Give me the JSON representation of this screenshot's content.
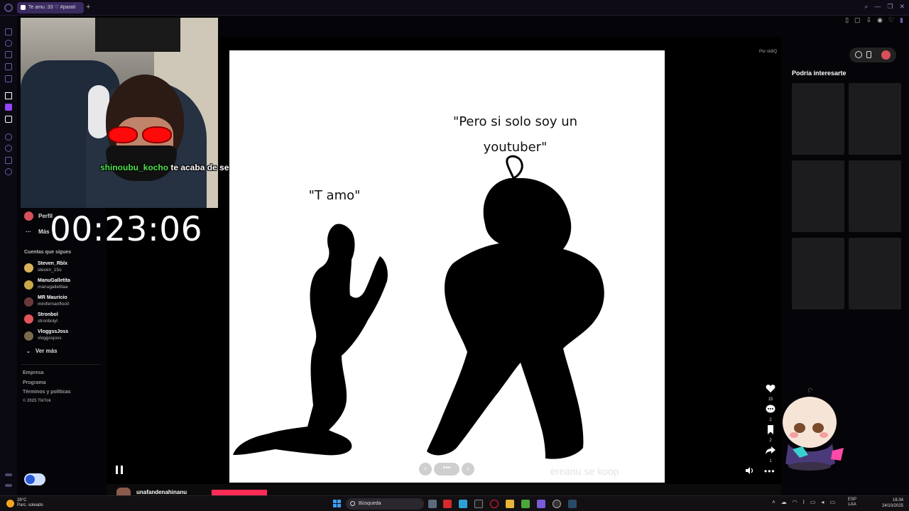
{
  "browser": {
    "tab_title": "Te amu :33 ♡ #parati",
    "new_tab": "+"
  },
  "stream_overlay": {
    "follow_user": "shinoubu_kocho",
    "follow_text": " te acaba de seguir!",
    "timer": "00:23:06"
  },
  "tiktok_nav": {
    "profile_label": "Perfil",
    "more_label": "Más",
    "following_title": "Cuentas que sigues",
    "accounts": [
      {
        "name": "Steven_Rblx",
        "handle": "steven_15o",
        "color": "#d9b25a"
      },
      {
        "name": "ManuGalletita",
        "handle": "manugalletitaa",
        "color": "#c9a84a"
      },
      {
        "name": "MR Mauricio",
        "handle": "minifernanfloo0",
        "color": "#6a3a3a"
      },
      {
        "name": "Stronbol",
        "handle": "stronbolyt",
        "color": "#e0555a"
      },
      {
        "name": "VloggssJoss",
        "handle": "vloggssjoss",
        "color": "#7a6a4a"
      }
    ],
    "see_more": "Ver más",
    "footer_links": [
      "Empresa",
      "Programa",
      "Términos y políticas"
    ],
    "copyright": "© 2025 TikTok"
  },
  "video": {
    "caption_left": "\"T amo\"",
    "caption_right_line1": "\"Pero si solo soy un",
    "caption_right_line2": "youtuber\"",
    "watermark": "ereanu se koop",
    "carousel_prev": "‹",
    "carousel_dots": "•••",
    "carousel_next": "›"
  },
  "sidebar_right": {
    "by_vidiq": "Por vidIQ",
    "suggest_title": "Podría interesarte"
  },
  "actions": {
    "likes": "15",
    "comments": "2",
    "saves": "2",
    "shares": "1",
    "more": "•••"
  },
  "bottom": {
    "username": "unafandenahinanu"
  },
  "taskbar": {
    "temp": "28°C",
    "weather": "Parc. soleado",
    "search_placeholder": "Búsqueda",
    "lang_top": "ESP",
    "lang_bottom": "LAA",
    "time": "16:34",
    "date": "24/10/2025"
  },
  "colors": {
    "accent_purple": "#6c5ca8",
    "tiktok_red": "#fe2c55",
    "follow_green": "#4fe44f"
  }
}
